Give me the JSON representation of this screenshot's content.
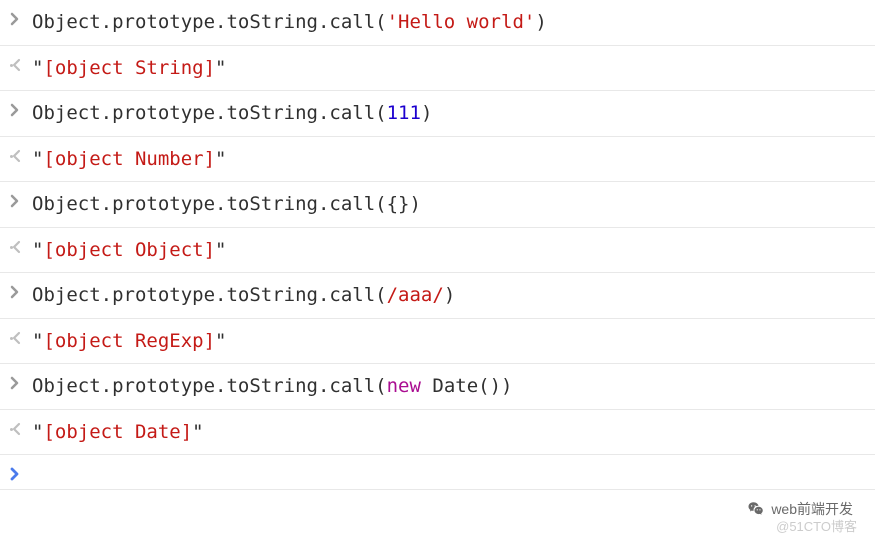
{
  "lines": [
    {
      "type": "input",
      "tokens": [
        {
          "cls": "t-default",
          "text": "Object.prototype.toString.call("
        },
        {
          "cls": "t-string",
          "text": "'Hello world'"
        },
        {
          "cls": "t-default",
          "text": ")"
        }
      ]
    },
    {
      "type": "output",
      "tokens": [
        {
          "cls": "t-rquote",
          "text": "\""
        },
        {
          "cls": "t-rbracket",
          "text": "[object String]"
        },
        {
          "cls": "t-rquote",
          "text": "\""
        }
      ]
    },
    {
      "type": "input",
      "tokens": [
        {
          "cls": "t-default",
          "text": "Object.prototype.toString.call("
        },
        {
          "cls": "t-number",
          "text": "111"
        },
        {
          "cls": "t-default",
          "text": ")"
        }
      ]
    },
    {
      "type": "output",
      "tokens": [
        {
          "cls": "t-rquote",
          "text": "\""
        },
        {
          "cls": "t-rbracket",
          "text": "[object Number]"
        },
        {
          "cls": "t-rquote",
          "text": "\""
        }
      ]
    },
    {
      "type": "input",
      "tokens": [
        {
          "cls": "t-default",
          "text": "Object.prototype.toString.call({})"
        }
      ]
    },
    {
      "type": "output",
      "tokens": [
        {
          "cls": "t-rquote",
          "text": "\""
        },
        {
          "cls": "t-rbracket",
          "text": "[object Object]"
        },
        {
          "cls": "t-rquote",
          "text": "\""
        }
      ]
    },
    {
      "type": "input",
      "tokens": [
        {
          "cls": "t-default",
          "text": "Object.prototype.toString.call("
        },
        {
          "cls": "t-regex",
          "text": "/aaa/"
        },
        {
          "cls": "t-default",
          "text": ")"
        }
      ]
    },
    {
      "type": "output",
      "tokens": [
        {
          "cls": "t-rquote",
          "text": "\""
        },
        {
          "cls": "t-rbracket",
          "text": "[object RegExp]"
        },
        {
          "cls": "t-rquote",
          "text": "\""
        }
      ]
    },
    {
      "type": "input",
      "tokens": [
        {
          "cls": "t-default",
          "text": "Object.prototype.toString.call("
        },
        {
          "cls": "t-keyword",
          "text": "new"
        },
        {
          "cls": "t-default",
          "text": " Date())"
        }
      ]
    },
    {
      "type": "output",
      "tokens": [
        {
          "cls": "t-rquote",
          "text": "\""
        },
        {
          "cls": "t-rbracket",
          "text": "[object Date]"
        },
        {
          "cls": "t-rquote",
          "text": "\""
        }
      ]
    },
    {
      "type": "cursor",
      "tokens": []
    }
  ],
  "watermark": {
    "text1": "web前端开发",
    "text2": "@51CTO博客"
  }
}
